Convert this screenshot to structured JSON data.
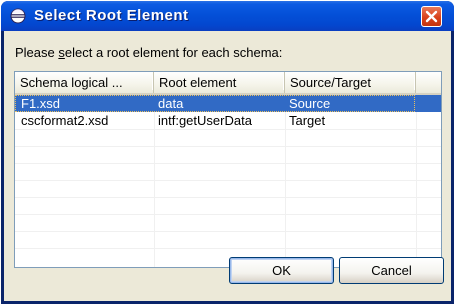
{
  "window": {
    "title": "Select Root Element",
    "icons": {
      "app": "eclipse-icon",
      "close": "close-x-icon"
    }
  },
  "dialog": {
    "instructions_before": "Please ",
    "instructions_mnemonic": "s",
    "instructions_after": "elect a root element for each schema:"
  },
  "table": {
    "columns": [
      "Schema logical ...",
      "Root element",
      "Source/Target"
    ],
    "rows": [
      {
        "schema": "F1.xsd",
        "root": "data",
        "role": "Source",
        "selected": true
      },
      {
        "schema": "cscformat2.xsd",
        "root": "intf:getUserData",
        "role": "Target",
        "selected": false
      }
    ]
  },
  "buttons": {
    "ok": "OK",
    "cancel": "Cancel"
  },
  "colors": {
    "titlebar": "#0450d8",
    "selection": "#316ac5",
    "dialog_bg": "#ece9d8",
    "close_button": "#d9421c"
  }
}
